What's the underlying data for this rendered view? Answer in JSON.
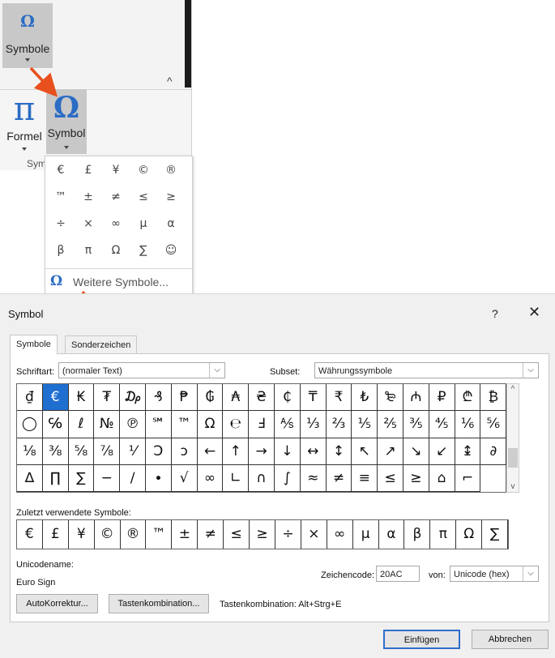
{
  "ribbon_top": {
    "symbole_label": "Symbole",
    "omega": "Ω",
    "collapse": "^"
  },
  "ribbon_second": {
    "formel_label": "Formel",
    "symbol_label": "Symbol",
    "pi": "π",
    "omega": "Ω",
    "group_label": "Sym"
  },
  "gallery": {
    "symbols": [
      "€",
      "£",
      "¥",
      "©",
      "®",
      "™",
      "±",
      "≠",
      "≤",
      "≥",
      "÷",
      "×",
      "∞",
      "µ",
      "α",
      "β",
      "π",
      "Ω",
      "∑",
      "☺"
    ],
    "more_label": "Weitere Symbole...",
    "more_icon": "Ω"
  },
  "dialog": {
    "title": "Symbol",
    "help": "?",
    "close": "✕",
    "tabs": [
      "Symbole",
      "Sonderzeichen"
    ],
    "font_label": "Schriftart:",
    "font_value": "(normaler Text)",
    "subset_label": "Subset:",
    "subset_value": "Währungssymbole",
    "grid_symbols": [
      "₫",
      "€",
      "₭",
      "₮",
      "₯",
      "₰",
      "₱",
      "₲",
      "₳",
      "₴",
      "₵",
      "₸",
      "₹",
      "₺",
      "₻",
      "₼",
      "₽",
      "₾",
      "₿",
      "◯",
      "℅",
      "ℓ",
      "№",
      "℗",
      "℠",
      "™",
      "Ω",
      "℮",
      "Ⅎ",
      "⅍",
      "⅓",
      "⅔",
      "⅕",
      "⅖",
      "⅗",
      "⅘",
      "⅙",
      "⅚",
      "⅛",
      "⅜",
      "⅝",
      "⅞",
      "⅟",
      "Ↄ",
      "ↄ",
      "←",
      "↑",
      "→",
      "↓",
      "↔",
      "↕",
      "↖",
      "↗",
      "↘",
      "↙",
      "↨",
      "∂",
      "∆",
      "∏",
      "∑",
      "−",
      "∕",
      "∙",
      "√",
      "∞",
      "∟",
      "∩",
      "∫",
      "≈",
      "≠",
      "≡",
      "≤",
      "≥",
      "⌂",
      "⌐"
    ],
    "recent_label": "Zuletzt verwendete Symbole:",
    "recent_symbols": [
      "€",
      "£",
      "¥",
      "©",
      "®",
      "™",
      "±",
      "≠",
      "≤",
      "≥",
      "÷",
      "×",
      "∞",
      "µ",
      "α",
      "β",
      "π",
      "Ω",
      "∑"
    ],
    "unicode_name_label": "Unicodename:",
    "unicode_name_value": "Euro Sign",
    "charcode_label": "Zeichencode:",
    "charcode_value": "20AC",
    "from_label": "von:",
    "from_value": "Unicode (hex)",
    "autocorrect_button": "AutoKorrektur...",
    "shortcut_button": "Tastenkombination...",
    "shortcut_text": "Tastenkombination: Alt+Strg+E",
    "insert_button": "Einfügen",
    "cancel_button": "Abbrechen"
  },
  "colors": {
    "accent": "#2b6cc4",
    "arrow": "#e8501e",
    "selected": "#1f6fd0"
  }
}
